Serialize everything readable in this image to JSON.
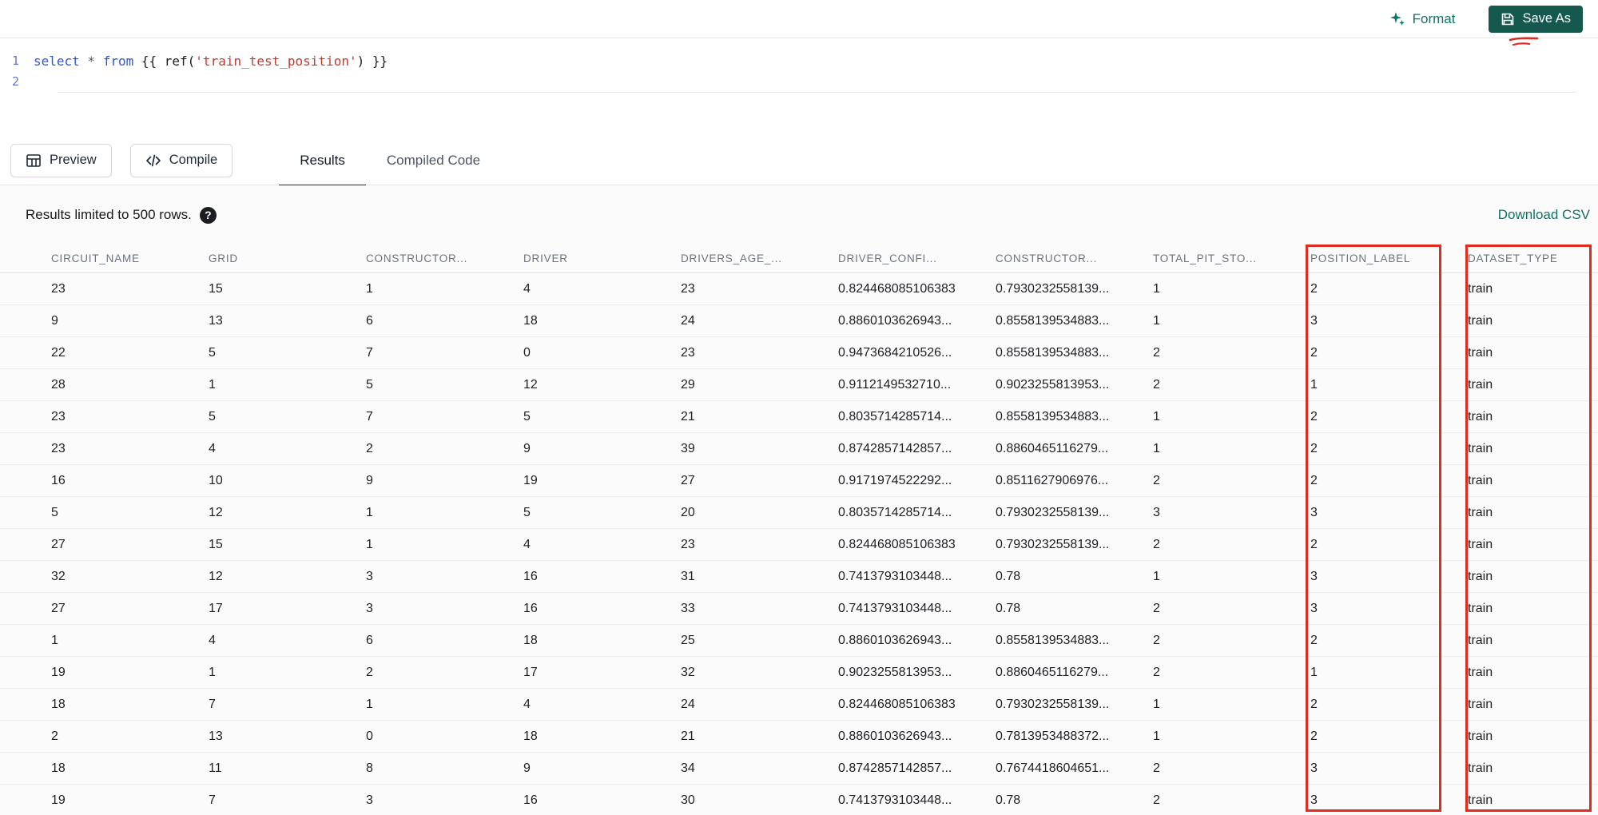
{
  "colors": {
    "accent": "#0E7365",
    "save_button": "#14584E",
    "annotation_red": "#E02B20",
    "keyword_blue": "#2F55D4",
    "string_red": "#C9372C"
  },
  "icons": {
    "format": "sparkle-icon",
    "save": "save-icon",
    "preview": "table-icon",
    "compile": "code-icon",
    "help": "?"
  },
  "topbar": {
    "format_label": "Format",
    "save_as_label": "Save As"
  },
  "editor": {
    "lines": [
      {
        "number": "1",
        "segments": [
          {
            "type": "keyword",
            "text": "select"
          },
          {
            "type": "operator",
            "text": " * "
          },
          {
            "type": "keyword",
            "text": "from"
          },
          {
            "type": "jinja",
            "text": " {{ "
          },
          {
            "type": "function",
            "text": "ref("
          },
          {
            "type": "string",
            "text": "'train_test_position'"
          },
          {
            "type": "function",
            "text": ")"
          },
          {
            "type": "jinja",
            "text": " }}"
          }
        ]
      },
      {
        "number": "2",
        "segments": []
      }
    ]
  },
  "toolbar": {
    "preview_label": "Preview",
    "compile_label": "Compile",
    "tabs": [
      {
        "label": "Results",
        "active": true
      },
      {
        "label": "Compiled Code",
        "active": false
      }
    ]
  },
  "results": {
    "limit_text": "Results limited to 500 rows.",
    "download_label": "Download CSV"
  },
  "table": {
    "columns": [
      "CIRCUIT_NAME",
      "GRID",
      "CONSTRUCTOR...",
      "DRIVER",
      "DRIVERS_AGE_...",
      "DRIVER_CONFI...",
      "CONSTRUCTOR...",
      "TOTAL_PIT_STO...",
      "POSITION_LABEL",
      "DATASET_TYPE"
    ],
    "rows": [
      [
        "23",
        "15",
        "1",
        "4",
        "23",
        "0.824468085106383",
        "0.7930232558139...",
        "1",
        "2",
        "train"
      ],
      [
        "9",
        "13",
        "6",
        "18",
        "24",
        "0.8860103626943...",
        "0.8558139534883...",
        "1",
        "3",
        "train"
      ],
      [
        "22",
        "5",
        "7",
        "0",
        "23",
        "0.9473684210526...",
        "0.8558139534883...",
        "2",
        "2",
        "train"
      ],
      [
        "28",
        "1",
        "5",
        "12",
        "29",
        "0.9112149532710...",
        "0.9023255813953...",
        "2",
        "1",
        "train"
      ],
      [
        "23",
        "5",
        "7",
        "5",
        "21",
        "0.8035714285714...",
        "0.8558139534883...",
        "1",
        "2",
        "train"
      ],
      [
        "23",
        "4",
        "2",
        "9",
        "39",
        "0.8742857142857...",
        "0.8860465116279...",
        "1",
        "2",
        "train"
      ],
      [
        "16",
        "10",
        "9",
        "19",
        "27",
        "0.9171974522292...",
        "0.8511627906976...",
        "2",
        "2",
        "train"
      ],
      [
        "5",
        "12",
        "1",
        "5",
        "20",
        "0.8035714285714...",
        "0.7930232558139...",
        "3",
        "3",
        "train"
      ],
      [
        "27",
        "15",
        "1",
        "4",
        "23",
        "0.824468085106383",
        "0.7930232558139...",
        "2",
        "2",
        "train"
      ],
      [
        "32",
        "12",
        "3",
        "16",
        "31",
        "0.7413793103448...",
        "0.78",
        "1",
        "3",
        "train"
      ],
      [
        "27",
        "17",
        "3",
        "16",
        "33",
        "0.7413793103448...",
        "0.78",
        "2",
        "3",
        "train"
      ],
      [
        "1",
        "4",
        "6",
        "18",
        "25",
        "0.8860103626943...",
        "0.8558139534883...",
        "2",
        "2",
        "train"
      ],
      [
        "19",
        "1",
        "2",
        "17",
        "32",
        "0.9023255813953...",
        "0.8860465116279...",
        "2",
        "1",
        "train"
      ],
      [
        "18",
        "7",
        "1",
        "4",
        "24",
        "0.824468085106383",
        "0.7930232558139...",
        "1",
        "2",
        "train"
      ],
      [
        "2",
        "13",
        "0",
        "18",
        "21",
        "0.8860103626943...",
        "0.7813953488372...",
        "1",
        "2",
        "train"
      ],
      [
        "18",
        "11",
        "8",
        "9",
        "34",
        "0.8742857142857...",
        "0.7674418604651...",
        "2",
        "3",
        "train"
      ],
      [
        "19",
        "7",
        "3",
        "16",
        "30",
        "0.7413793103448...",
        "0.78",
        "2",
        "3",
        "train"
      ]
    ]
  }
}
